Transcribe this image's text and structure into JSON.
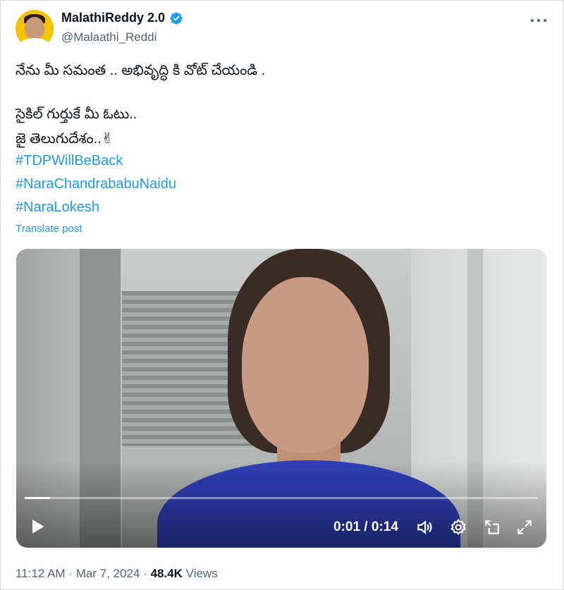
{
  "author": {
    "display_name": "MalathiReddy 2.0",
    "handle": "@Malaathi_Reddi"
  },
  "post": {
    "lines": [
      "నేను మీ సమంత .. అభివృద్ధి కి వోట్ చేయండి .",
      "సైకిల్ గుర్తుకే మీ ఓటు..",
      "జై తెలుగుదేశం..✌"
    ],
    "hashtags": [
      "#TDPWillBeBack",
      "#NaraChandrababuNaidu",
      "#NaraLokesh"
    ],
    "translate_label": "Translate post"
  },
  "video": {
    "current_time": "0:01",
    "duration": "0:14",
    "time_display": "0:01 / 0:14",
    "progress_fraction": 0.05
  },
  "meta": {
    "time": "11:12 AM",
    "date": "Mar 7, 2024",
    "views_count": "48.4K",
    "views_label": "Views"
  },
  "colors": {
    "link": "#1d9bf0",
    "verified": "#1d9bf0",
    "text_primary": "#0f1419",
    "text_secondary": "#536471"
  },
  "icons": [
    "verified-badge-icon",
    "more-options-icon",
    "play-icon",
    "volume-icon",
    "settings-icon",
    "pip-icon",
    "fullscreen-icon"
  ]
}
